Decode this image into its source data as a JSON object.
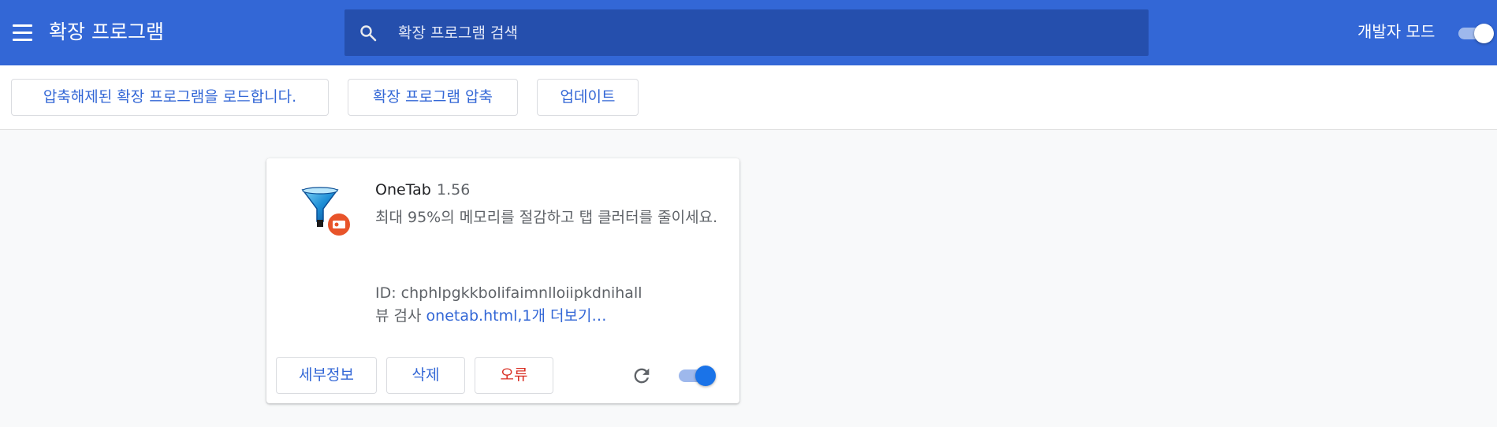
{
  "header": {
    "title": "확장 프로그램",
    "menu_icon": "hamburger-menu-icon",
    "search": {
      "placeholder": "확장 프로그램 검색",
      "value": "",
      "icon": "search-icon"
    },
    "dev_mode": {
      "label": "개발자 모드",
      "enabled": true
    }
  },
  "toolbar": {
    "load_unpacked_label": "압축해제된 확장 프로그램을 로드합니다.",
    "pack_label": "확장 프로그램 압축",
    "update_label": "업데이트"
  },
  "extension": {
    "name": "OneTab",
    "version": "1.56",
    "icon": "onetab-funnel-icon",
    "description": "최대 95%의 메모리를 절감하고 탭 클러터를 줄이세요.",
    "id_text": "ID: chphlpgkkbolifaimnlloiipkdnihall",
    "inspect_label": "뷰 검사",
    "inspect_link": "onetab.html",
    "more_link": ",1개 더보기…",
    "details_label": "세부정보",
    "remove_label": "삭제",
    "errors_label": "오류",
    "reload_icon": "reload-icon",
    "enabled": true
  },
  "colors": {
    "header_bg": "#3367d6",
    "search_bg": "#254fad",
    "accent": "#3367d6",
    "error": "#d93025",
    "toggle_on": "#1a73e8"
  }
}
